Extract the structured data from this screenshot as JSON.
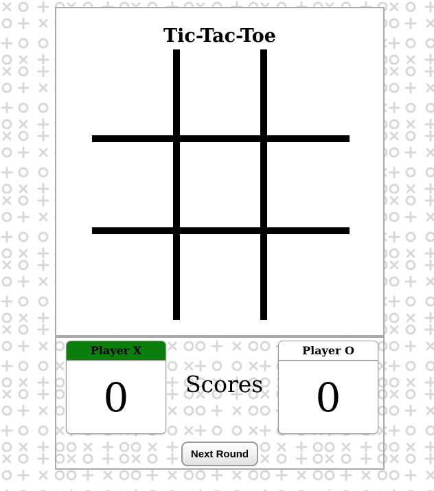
{
  "game": {
    "title": "Tic-Tac-Toe",
    "board": [
      "",
      "",
      "",
      "",
      "",
      "",
      "",
      "",
      ""
    ]
  },
  "scoreboard": {
    "label": "Scores",
    "player_x": {
      "label": "Player X",
      "score": "0",
      "active": true,
      "active_color": "#0c7e0c"
    },
    "player_o": {
      "label": "Player O",
      "score": "0",
      "active": false
    }
  },
  "controls": {
    "next_round_label": "Next Round"
  },
  "theme": {
    "background_pattern_color": "#d8d8d8",
    "border_color": "#a9a9a9",
    "grid_color": "#000000"
  }
}
